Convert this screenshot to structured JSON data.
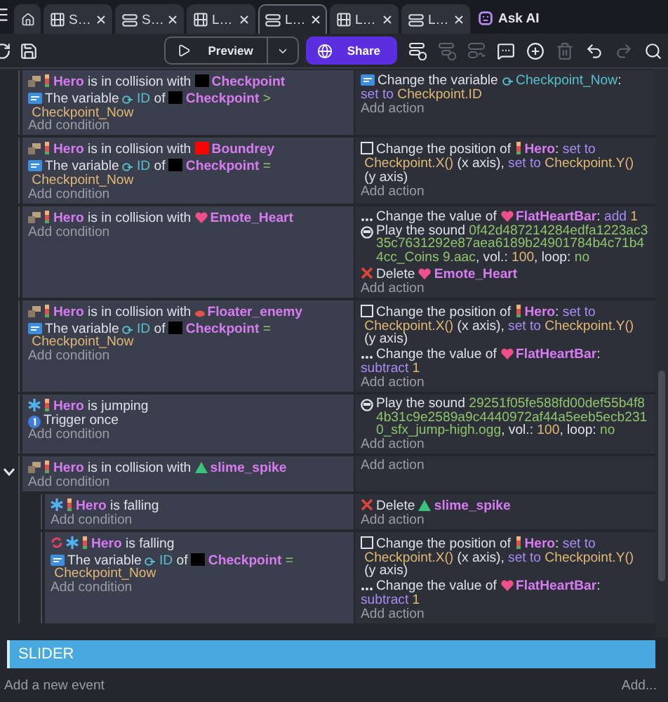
{
  "tabs": [
    {
      "kind": "home",
      "selected": false
    },
    {
      "kind": "scene",
      "label": "S…",
      "selected": false
    },
    {
      "kind": "events",
      "label": "S…",
      "selected": false
    },
    {
      "kind": "scene",
      "label": "L…",
      "selected": false
    },
    {
      "kind": "events",
      "label": "L…",
      "selected": true
    },
    {
      "kind": "scene",
      "label": "L…",
      "selected": false
    },
    {
      "kind": "events",
      "label": "L…",
      "selected": false
    }
  ],
  "ask_ai": "Ask AI",
  "toolbar": {
    "preview": "Preview",
    "share": "Share",
    "tools": [
      {
        "kind": "add-event",
        "disabled": false
      },
      {
        "kind": "add-subevent",
        "disabled": true
      },
      {
        "kind": "add-other",
        "disabled": true
      },
      {
        "kind": "comment",
        "disabled": false
      },
      {
        "kind": "add",
        "disabled": false
      },
      {
        "kind": "delete",
        "disabled": true
      },
      {
        "kind": "undo",
        "disabled": false
      },
      {
        "kind": "redo",
        "disabled": true
      },
      {
        "kind": "search",
        "disabled": false
      }
    ]
  },
  "events": [
    {
      "conditions": [
        {
          "kind": "collision",
          "parts": [
            {
              "kind": "hero",
              "text": "Hero"
            },
            {
              "kind": "t",
              "text": " is in collision with "
            },
            {
              "kind": "box",
              "color": "#000000",
              "text": "Checkpoint"
            }
          ]
        },
        {
          "kind": "variable",
          "parts": [
            {
              "kind": "t",
              "text": "The variable "
            },
            {
              "kind": "variable",
              "text": "ID"
            },
            {
              "kind": "t",
              "text": " of "
            },
            {
              "kind": "box",
              "color": "#000000",
              "text": "Checkpoint"
            },
            {
              "kind": "op",
              "text": " >"
            },
            {
              "kind": "expr",
              "text": " Checkpoint_Now"
            }
          ]
        }
      ],
      "add_condition": "Add condition",
      "actions": [
        {
          "kind": "variable",
          "parts": [
            {
              "kind": "t",
              "text": "Change the variable "
            },
            {
              "kind": "variable",
              "text": "Checkpoint_Now"
            },
            {
              "kind": "t",
              "text": ": "
            },
            {
              "kind": "keyword",
              "text": "set to"
            },
            {
              "kind": "expr",
              "text": " Checkpoint.ID"
            }
          ]
        }
      ],
      "add_action": "Add action"
    },
    {
      "conditions": [
        {
          "kind": "collision",
          "parts": [
            {
              "kind": "hero",
              "text": "Hero"
            },
            {
              "kind": "t",
              "text": " is in collision with "
            },
            {
              "kind": "box",
              "color": "#ff0000",
              "text": "Boundrey"
            }
          ]
        },
        {
          "kind": "variable",
          "parts": [
            {
              "kind": "t",
              "text": "The variable "
            },
            {
              "kind": "variable",
              "text": "ID"
            },
            {
              "kind": "t",
              "text": " of "
            },
            {
              "kind": "box",
              "color": "#000000",
              "text": "Checkpoint"
            },
            {
              "kind": "op",
              "text": " ="
            },
            {
              "kind": "expr",
              "text": " Checkpoint_Now"
            }
          ]
        }
      ],
      "add_condition": "Add condition",
      "actions": [
        {
          "kind": "position",
          "parts": [
            {
              "kind": "t",
              "text": "Change the position of "
            },
            {
              "kind": "hero",
              "text": "Hero"
            },
            {
              "kind": "t",
              "text": ": "
            },
            {
              "kind": "keyword",
              "text": "set to"
            },
            {
              "kind": "expr",
              "text": " Checkpoint.X()"
            },
            {
              "kind": "t",
              "text": " (x axis), "
            },
            {
              "kind": "keyword",
              "text": "set to"
            },
            {
              "kind": "expr",
              "text": " Checkpoint.Y()"
            },
            {
              "kind": "t",
              "text": " (y axis)"
            }
          ]
        }
      ],
      "add_action": "Add action"
    },
    {
      "conditions": [
        {
          "kind": "collision",
          "parts": [
            {
              "kind": "hero",
              "text": "Hero"
            },
            {
              "kind": "t",
              "text": " is in collision with "
            },
            {
              "kind": "heart",
              "text": "Emote_Heart"
            }
          ]
        }
      ],
      "add_condition": "Add condition",
      "actions": [
        {
          "kind": "value",
          "parts": [
            {
              "kind": "t",
              "text": "Change the value of "
            },
            {
              "kind": "heart",
              "text": "FlatHeartBar"
            },
            {
              "kind": "t",
              "text": ": "
            },
            {
              "kind": "keyword",
              "text": "add"
            },
            {
              "kind": "expr",
              "text": " 1"
            }
          ]
        },
        {
          "kind": "sound",
          "parts": [
            {
              "kind": "t",
              "text": "Play the sound "
            },
            {
              "kind": "file",
              "text": "0f42d487214284edfa1223ac335c7631292e87aea6189b24901784b4c71b44cc_Coins 9.aac"
            },
            {
              "kind": "t",
              "text": ", vol.: "
            },
            {
              "kind": "expr",
              "text": "100"
            },
            {
              "kind": "t",
              "text": ", loop: "
            },
            {
              "kind": "file",
              "text": "no"
            }
          ]
        },
        {
          "kind": "delete",
          "parts": [
            {
              "kind": "t",
              "text": "Delete "
            },
            {
              "kind": "heart",
              "text": "Emote_Heart"
            }
          ]
        }
      ],
      "add_action": "Add action"
    },
    {
      "conditions": [
        {
          "kind": "collision",
          "parts": [
            {
              "kind": "hero",
              "text": "Hero"
            },
            {
              "kind": "t",
              "text": " is in collision with "
            },
            {
              "kind": "enemy",
              "text": "Floater_enemy"
            }
          ]
        },
        {
          "kind": "variable",
          "parts": [
            {
              "kind": "t",
              "text": "The variable "
            },
            {
              "kind": "variable",
              "text": "ID"
            },
            {
              "kind": "t",
              "text": " of "
            },
            {
              "kind": "box",
              "color": "#000000",
              "text": "Checkpoint"
            },
            {
              "kind": "op",
              "text": " ="
            },
            {
              "kind": "expr",
              "text": " Checkpoint_Now"
            }
          ]
        }
      ],
      "add_condition": "Add condition",
      "actions": [
        {
          "kind": "position",
          "parts": [
            {
              "kind": "t",
              "text": "Change the position of "
            },
            {
              "kind": "hero",
              "text": "Hero"
            },
            {
              "kind": "t",
              "text": ": "
            },
            {
              "kind": "keyword",
              "text": "set to"
            },
            {
              "kind": "expr",
              "text": " Checkpoint.X()"
            },
            {
              "kind": "t",
              "text": " (x axis), "
            },
            {
              "kind": "keyword",
              "text": "set to"
            },
            {
              "kind": "expr",
              "text": " Checkpoint.Y()"
            },
            {
              "kind": "t",
              "text": " (y axis)"
            }
          ]
        },
        {
          "kind": "value",
          "parts": [
            {
              "kind": "t",
              "text": "Change the value of "
            },
            {
              "kind": "heart",
              "text": "FlatHeartBar"
            },
            {
              "kind": "t",
              "text": ": "
            },
            {
              "kind": "keyword",
              "text": "subtract"
            },
            {
              "kind": "expr",
              "text": " 1"
            }
          ]
        }
      ],
      "add_action": "Add action"
    },
    {
      "conditions": [
        {
          "kind": "motion",
          "parts": [
            {
              "kind": "hero",
              "text": "Hero"
            },
            {
              "kind": "t",
              "text": " is jumping"
            }
          ]
        },
        {
          "kind": "once",
          "parts": [
            {
              "kind": "t",
              "text": "Trigger once"
            }
          ]
        }
      ],
      "add_condition": "Add condition",
      "actions": [
        {
          "kind": "sound",
          "parts": [
            {
              "kind": "t",
              "text": "Play the sound "
            },
            {
              "kind": "file",
              "text": "29251f05fe588fd00def55b4f84b31c9e2589a9c4440972af44a5eeb5ecb2310_sfx_jump-high.ogg"
            },
            {
              "kind": "t",
              "text": ", vol.: "
            },
            {
              "kind": "expr",
              "text": "100"
            },
            {
              "kind": "t",
              "text": ", loop: "
            },
            {
              "kind": "file",
              "text": "no"
            }
          ]
        }
      ],
      "add_action": "Add action"
    },
    {
      "expanded": true,
      "conditions": [
        {
          "kind": "collision",
          "parts": [
            {
              "kind": "hero",
              "text": "Hero"
            },
            {
              "kind": "t",
              "text": " is in collision with "
            },
            {
              "kind": "slime",
              "text": "slime_spike"
            }
          ]
        }
      ],
      "add_condition": "Add condition",
      "add_action": "Add action",
      "children": [
        {
          "conditions": [
            {
              "kind": "motion",
              "parts": [
                {
                  "kind": "hero",
                  "text": "Hero"
                },
                {
                  "kind": "t",
                  "text": " is falling"
                }
              ]
            }
          ],
          "add_condition": "Add condition",
          "actions": [
            {
              "kind": "delete",
              "parts": [
                {
                  "kind": "t",
                  "text": "Delete "
                },
                {
                  "kind": "slime",
                  "text": "slime_spike"
                }
              ]
            }
          ],
          "add_action": "Add action"
        },
        {
          "conditions": [
            {
              "kind": "motion",
              "inverted": true,
              "parts": [
                {
                  "kind": "hero",
                  "text": "Hero"
                },
                {
                  "kind": "t",
                  "text": " is falling"
                }
              ]
            },
            {
              "kind": "variable",
              "parts": [
                {
                  "kind": "t",
                  "text": "The variable "
                },
                {
                  "kind": "variable",
                  "text": "ID"
                },
                {
                  "kind": "t",
                  "text": " of "
                },
                {
                  "kind": "box",
                  "color": "#000000",
                  "text": "Checkpoint"
                },
                {
                  "kind": "op",
                  "text": " ="
                },
                {
                  "kind": "expr",
                  "text": " Checkpoint_Now"
                }
              ]
            }
          ],
          "add_condition": "Add condition",
          "actions": [
            {
              "kind": "position",
              "parts": [
                {
                  "kind": "t",
                  "text": "Change the position of "
                },
                {
                  "kind": "hero",
                  "text": "Hero"
                },
                {
                  "kind": "t",
                  "text": ": "
                },
                {
                  "kind": "keyword",
                  "text": "set to"
                },
                {
                  "kind": "expr",
                  "text": " Checkpoint.X()"
                },
                {
                  "kind": "t",
                  "text": " (x axis), "
                },
                {
                  "kind": "keyword",
                  "text": "set to"
                },
                {
                  "kind": "expr",
                  "text": " Checkpoint.Y()"
                },
                {
                  "kind": "t",
                  "text": " (y axis)"
                }
              ]
            },
            {
              "kind": "value",
              "parts": [
                {
                  "kind": "t",
                  "text": "Change the value of "
                },
                {
                  "kind": "heart",
                  "text": "FlatHeartBar"
                },
                {
                  "kind": "t",
                  "text": ": "
                },
                {
                  "kind": "keyword",
                  "text": "subtract"
                },
                {
                  "kind": "expr",
                  "text": " 1"
                }
              ]
            }
          ],
          "add_action": "Add action"
        }
      ]
    }
  ],
  "comment": "SLIDER",
  "footer": {
    "add_event": "Add a new event",
    "add_menu": "Add..."
  }
}
